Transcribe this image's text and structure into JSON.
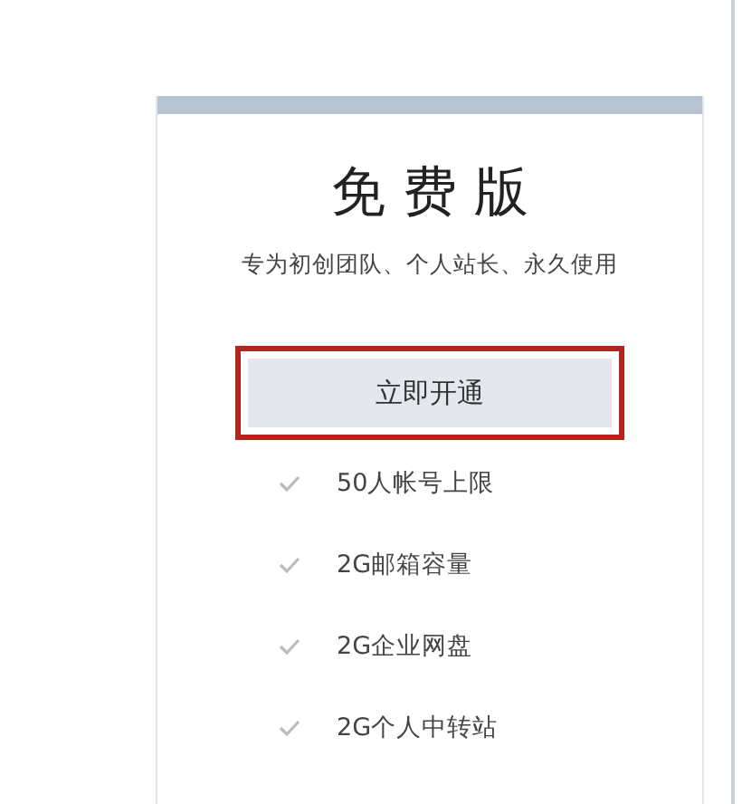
{
  "plan": {
    "title": "免 费 版",
    "subtitle": "专为初创团队、个人站长、永久使用",
    "button": {
      "label": "立即开通",
      "highlighted": true
    },
    "features": [
      {
        "text": "50人帐号上限",
        "checked": true
      },
      {
        "text": "2G邮箱容量",
        "checked": true
      },
      {
        "text": "2G企业网盘",
        "checked": true
      },
      {
        "text": "2G个人中转站",
        "checked": true
      }
    ]
  }
}
